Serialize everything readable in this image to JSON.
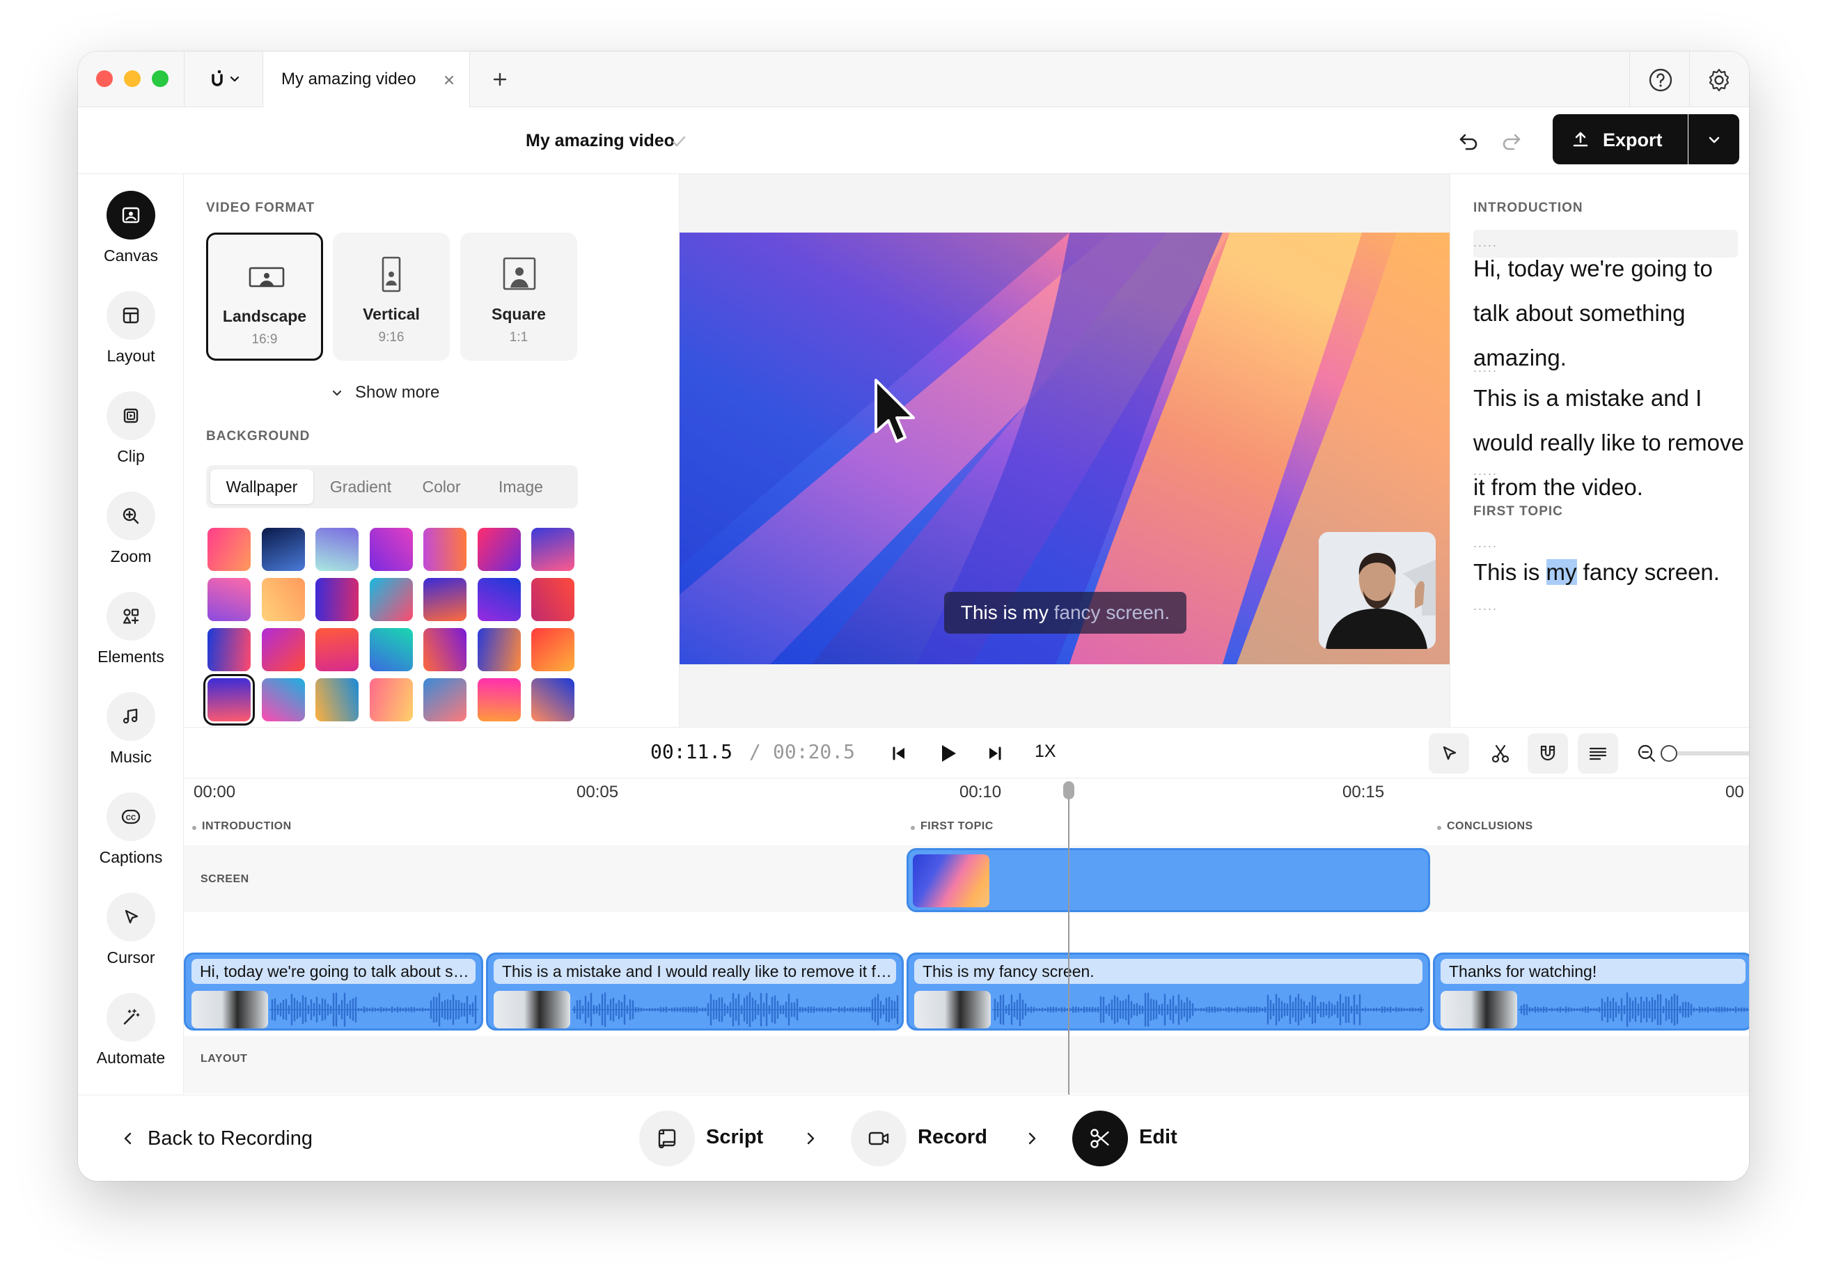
{
  "window": {
    "tab_title": "My amazing video",
    "document_title": "My amazing video",
    "export_label": "Export"
  },
  "rail": {
    "items": [
      {
        "label": "Canvas",
        "icon": "canvas-icon",
        "active": true
      },
      {
        "label": "Layout",
        "icon": "layout-icon"
      },
      {
        "label": "Clip",
        "icon": "clip-icon"
      },
      {
        "label": "Zoom",
        "icon": "zoom-icon"
      },
      {
        "label": "Elements",
        "icon": "elements-icon"
      },
      {
        "label": "Music",
        "icon": "music-icon"
      },
      {
        "label": "Captions",
        "icon": "captions-icon"
      },
      {
        "label": "Cursor",
        "icon": "cursor-icon"
      },
      {
        "label": "Automate",
        "icon": "automate-icon"
      }
    ]
  },
  "panel": {
    "video_format_title": "VIDEO FORMAT",
    "formats": [
      {
        "name": "Landscape",
        "ratio": "16:9",
        "selected": true
      },
      {
        "name": "Vertical",
        "ratio": "9:16"
      },
      {
        "name": "Square",
        "ratio": "1:1"
      }
    ],
    "show_more": "Show more",
    "background_title": "BACKGROUND",
    "background_tabs": [
      "Wallpaper",
      "Gradient",
      "Color",
      "Image"
    ],
    "background_tab_selected": "Wallpaper",
    "selected_wallpaper_index": 21
  },
  "preview": {
    "caption_plain": "This is my",
    "caption_faded": " fancy screen."
  },
  "script": {
    "sections": [
      {
        "title": "INTRODUCTION"
      },
      {
        "title": "FIRST TOPIC"
      }
    ],
    "paragraph1": "Hi, today we're going to talk about something amazing.",
    "paragraph2": "This is a mistake and I would really like to remove it from the video.",
    "paragraph3_before": "This is ",
    "paragraph3_highlight": "my",
    "paragraph3_after": " fancy screen.",
    "pause_marker": "....."
  },
  "transport": {
    "current_time": "00:11.5",
    "separator": "/",
    "total_time": "00:20.5",
    "speed": "1X",
    "zoom_level": 0.02
  },
  "timeline": {
    "ticks": [
      "00:00",
      "00:05",
      "00:10",
      "00:15",
      "00"
    ],
    "markers": [
      "INTRODUCTION",
      "FIRST TOPIC",
      "CONCLUSIONS"
    ],
    "lanes": {
      "screen": "SCREEN",
      "layout": "LAYOUT"
    },
    "clips": [
      "Hi, today we're going to talk about something amazing.",
      "This is a mistake and I would really like to remove it from the video.",
      "This is my fancy screen.",
      "Thanks for watching!"
    ],
    "playhead_time": "00:11.5"
  },
  "bottom": {
    "back_label": "Back to Recording",
    "steps": [
      {
        "label": "Script",
        "icon": "script-icon"
      },
      {
        "label": "Record",
        "icon": "camera-icon"
      },
      {
        "label": "Edit",
        "icon": "scissors-icon",
        "active": true
      }
    ]
  },
  "colors": {
    "accent": "#5aa0f7",
    "accent_dark": "#3f8ae8",
    "clip_caption_bg": "#cfe3fd",
    "primary_button": "#111111",
    "highlight": "#a9cdf7"
  }
}
